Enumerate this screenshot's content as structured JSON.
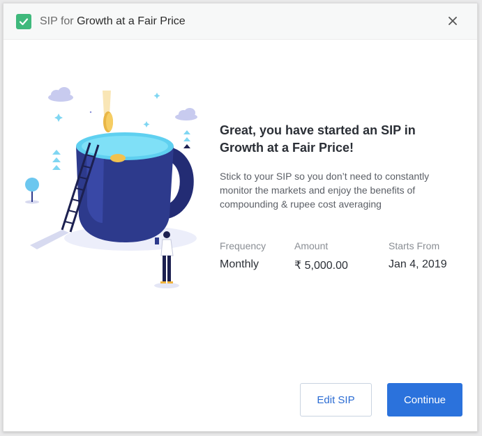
{
  "header": {
    "title_prefix": "SIP for",
    "title_strong": "Growth at a Fair Price",
    "check_icon": "checkmark-icon",
    "close_icon": "close-icon"
  },
  "content": {
    "headline": "Great, you have started an SIP in Growth at a Fair Price!",
    "description": "Stick to your SIP so you don’t need to constantly monitor the markets and enjoy the benefits of compounding & rupee cost averaging",
    "details": [
      {
        "label": "Frequency",
        "value": "Monthly"
      },
      {
        "label": "Amount",
        "value": "₹ 5,000.00"
      },
      {
        "label": "Starts From",
        "value": "Jan 4, 2019"
      }
    ]
  },
  "actions": {
    "edit_label": "Edit SIP",
    "continue_label": "Continue"
  },
  "colors": {
    "accent": "#2b72dc",
    "success": "#3fb97c",
    "mug": "#2d3a8c"
  }
}
